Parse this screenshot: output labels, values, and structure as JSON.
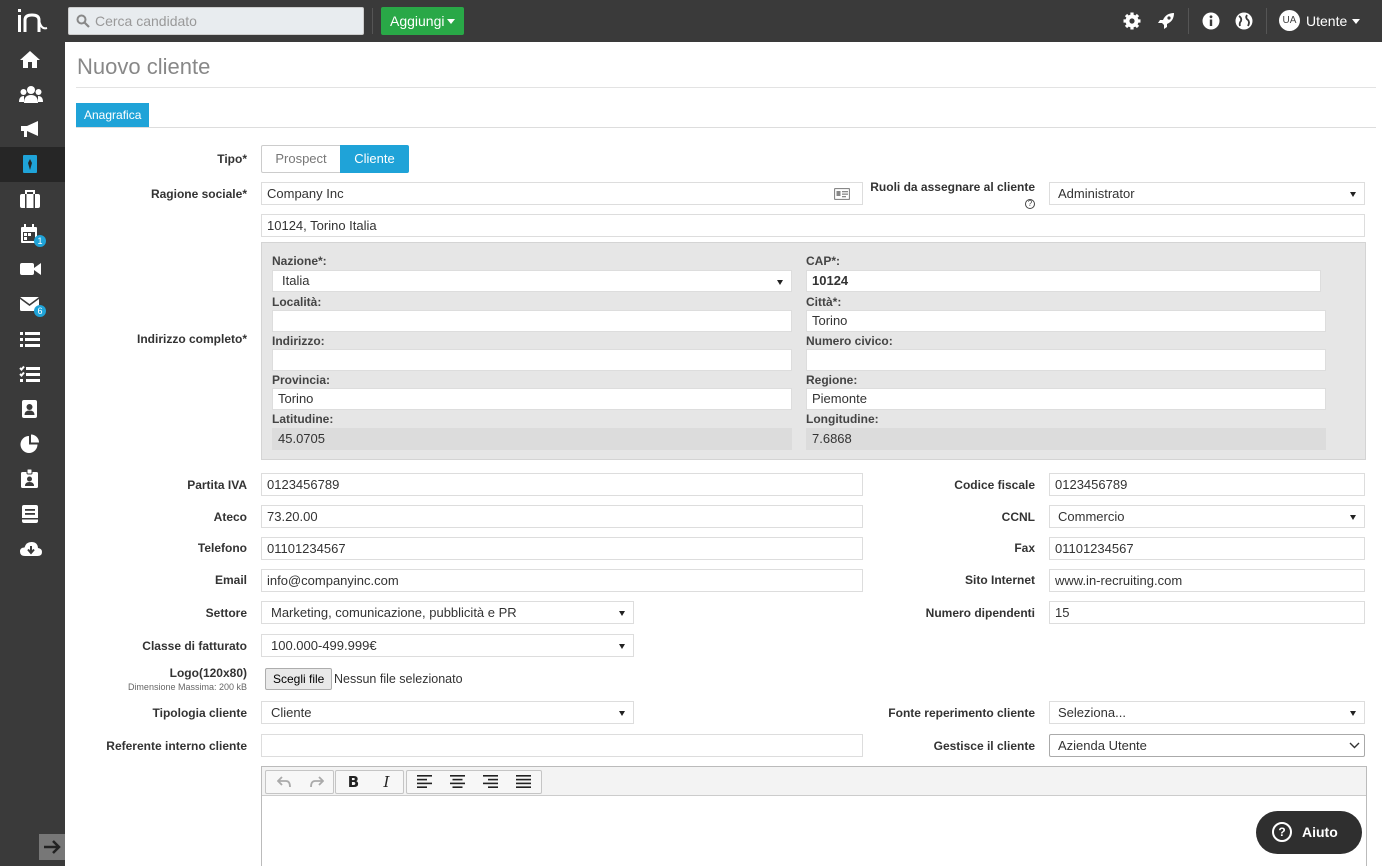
{
  "search": {
    "placeholder": "Cerca candidato"
  },
  "header": {
    "add_label": "Aggiungi",
    "user_initials": "UA",
    "user_name": "Utente"
  },
  "sidebar": {
    "items": [
      {
        "icon": "home-icon"
      },
      {
        "icon": "users-icon"
      },
      {
        "icon": "megaphone-icon"
      },
      {
        "icon": "client-icon",
        "active": true
      },
      {
        "icon": "briefcase-icon"
      },
      {
        "icon": "calendar-icon",
        "badge": "1"
      },
      {
        "icon": "video-icon"
      },
      {
        "icon": "envelope-icon",
        "badge": "6"
      },
      {
        "icon": "list-icon"
      },
      {
        "icon": "tasks-icon"
      },
      {
        "icon": "contact-card-icon"
      },
      {
        "icon": "pie-chart-icon"
      },
      {
        "icon": "id-badge-icon"
      },
      {
        "icon": "book-icon"
      },
      {
        "icon": "cloud-download-icon"
      }
    ]
  },
  "page": {
    "title": "Nuovo cliente",
    "tab": "Anagrafica"
  },
  "form": {
    "tipo": {
      "label": "Tipo*",
      "options": [
        "Prospect",
        "Cliente"
      ],
      "selected": "Cliente"
    },
    "ragione_sociale": {
      "label": "Ragione sociale*",
      "value": "Company Inc"
    },
    "ruoli": {
      "label": "Ruoli da assegnare al cliente",
      "value": "Administrator",
      "help": "?"
    },
    "indirizzo_completo": {
      "label": "Indirizzo completo*",
      "summary": "10124, Torino Italia",
      "nazione": {
        "label": "Nazione*:",
        "value": "Italia"
      },
      "cap": {
        "label": "CAP*:",
        "value": "10124"
      },
      "localita": {
        "label": "Località:",
        "value": ""
      },
      "citta": {
        "label": "Città*:",
        "value": "Torino"
      },
      "indirizzo": {
        "label": "Indirizzo:",
        "value": ""
      },
      "numero_civico": {
        "label": "Numero civico:",
        "value": ""
      },
      "provincia": {
        "label": "Provincia:",
        "value": "Torino"
      },
      "regione": {
        "label": "Regione:",
        "value": "Piemonte"
      },
      "latitudine": {
        "label": "Latitudine:",
        "value": "45.0705"
      },
      "longitudine": {
        "label": "Longitudine:",
        "value": "7.6868"
      }
    },
    "partita_iva": {
      "label": "Partita IVA",
      "value": "0123456789"
    },
    "codice_fiscale": {
      "label": "Codice fiscale",
      "value": "0123456789"
    },
    "ateco": {
      "label": "Ateco",
      "value": "73.20.00"
    },
    "ccnl": {
      "label": "CCNL",
      "value": "Commercio"
    },
    "telefono": {
      "label": "Telefono",
      "value": "01101234567"
    },
    "fax": {
      "label": "Fax",
      "value": "01101234567"
    },
    "email": {
      "label": "Email",
      "value": "info@companyinc.com"
    },
    "sito": {
      "label": "Sito Internet",
      "value": "www.in-recruiting.com"
    },
    "settore": {
      "label": "Settore",
      "value": "Marketing, comunicazione, pubblicità e PR"
    },
    "dipendenti": {
      "label": "Numero dipendenti",
      "value": "15"
    },
    "fatturato": {
      "label": "Classe di fatturato",
      "value": "100.000-499.999€"
    },
    "logo": {
      "label": "Logo(120x80)",
      "note": "Dimensione Massima: 200 kB",
      "button": "Scegli file",
      "status": "Nessun file selezionato"
    },
    "tipologia": {
      "label": "Tipologia cliente",
      "value": "Cliente"
    },
    "fonte": {
      "label": "Fonte reperimento cliente",
      "value": "Seleziona..."
    },
    "referente": {
      "label": "Referente interno cliente",
      "value": ""
    },
    "gestisce": {
      "label": "Gestisce il cliente",
      "value": "Azienda Utente"
    }
  },
  "editor": {
    "tools": [
      "undo-icon",
      "redo-icon",
      "bold-icon",
      "italic-icon",
      "align-left-icon",
      "align-center-icon",
      "align-right-icon",
      "align-justify-icon"
    ],
    "bold_glyph": "B",
    "italic_glyph": "I"
  },
  "help_button": {
    "label": "Aiuto"
  }
}
